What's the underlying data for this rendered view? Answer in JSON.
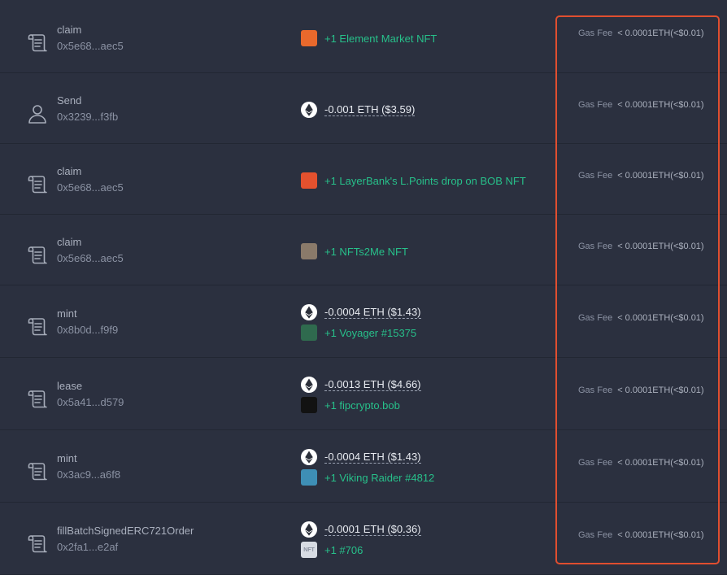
{
  "transactions": [
    {
      "method": "claim",
      "address": "0x5e68...aec5",
      "icon": "scroll-icon",
      "changes": [
        {
          "kind": "nft",
          "text": "+1 Element Market NFT",
          "nft_icon": "element-market-nft-icon",
          "bg": "#e9692c"
        }
      ],
      "gas": {
        "label": "Gas Fee",
        "value": "< 0.0001ETH(<$0.01)"
      }
    },
    {
      "method": "Send",
      "address": "0x3239...f3fb",
      "icon": "user-icon",
      "changes": [
        {
          "kind": "eth",
          "text": "-0.001 ETH ($3.59)"
        }
      ],
      "gas": {
        "label": "Gas Fee",
        "value": "< 0.0001ETH(<$0.01)"
      }
    },
    {
      "method": "claim",
      "address": "0x5e68...aec5",
      "icon": "scroll-icon",
      "changes": [
        {
          "kind": "nft",
          "text": "+1 LayerBank's L.Points drop on BOB NFT",
          "nft_icon": "layerbank-nft-icon",
          "bg": "#e4512e"
        }
      ],
      "gas": {
        "label": "Gas Fee",
        "value": "< 0.0001ETH(<$0.01)"
      }
    },
    {
      "method": "claim",
      "address": "0x5e68...aec5",
      "icon": "scroll-icon",
      "changes": [
        {
          "kind": "nft",
          "text": "+1 NFTs2Me NFT",
          "nft_icon": "nfts2me-nft-icon",
          "bg": "#8a7a6a"
        }
      ],
      "gas": {
        "label": "Gas Fee",
        "value": "< 0.0001ETH(<$0.01)"
      }
    },
    {
      "method": "mint",
      "address": "0x8b0d...f9f9",
      "icon": "scroll-icon",
      "changes": [
        {
          "kind": "eth",
          "text": "-0.0004 ETH ($1.43)"
        },
        {
          "kind": "nft",
          "text": "+1 Voyager #15375",
          "nft_icon": "voyager-nft-icon",
          "bg": "#2f6a4e"
        }
      ],
      "gas": {
        "label": "Gas Fee",
        "value": "< 0.0001ETH(<$0.01)"
      }
    },
    {
      "method": "lease",
      "address": "0x5a41...d579",
      "icon": "scroll-icon",
      "changes": [
        {
          "kind": "eth",
          "text": "-0.0013 ETH ($4.66)"
        },
        {
          "kind": "nft",
          "text": "+1 fipcrypto.bob",
          "nft_icon": "fipcrypto-nft-icon",
          "bg": "#121212"
        }
      ],
      "gas": {
        "label": "Gas Fee",
        "value": "< 0.0001ETH(<$0.01)"
      }
    },
    {
      "method": "mint",
      "address": "0x3ac9...a6f8",
      "icon": "scroll-icon",
      "changes": [
        {
          "kind": "eth",
          "text": "-0.0004 ETH ($1.43)"
        },
        {
          "kind": "nft",
          "text": "+1 Viking Raider #4812",
          "nft_icon": "viking-raider-nft-icon",
          "bg": "#3e8fb6"
        }
      ],
      "gas": {
        "label": "Gas Fee",
        "value": "< 0.0001ETH(<$0.01)"
      }
    },
    {
      "method": "fillBatchSignedERC721Order",
      "address": "0x2fa1...e2af",
      "icon": "scroll-icon",
      "changes": [
        {
          "kind": "eth",
          "text": "-0.0001 ETH ($0.36)"
        },
        {
          "kind": "nft",
          "text": "+1 #706",
          "nft_icon": "generic-nft-icon",
          "bg": "#d7dbe3",
          "badge_text": "NFT"
        }
      ],
      "gas": {
        "label": "Gas Fee",
        "value": "< 0.0001ETH(<$0.01)"
      }
    }
  ],
  "colors": {
    "background": "#2b303f",
    "positive": "#27c08a",
    "negative": "#e8ebf1",
    "highlight": "#e04e2f"
  }
}
